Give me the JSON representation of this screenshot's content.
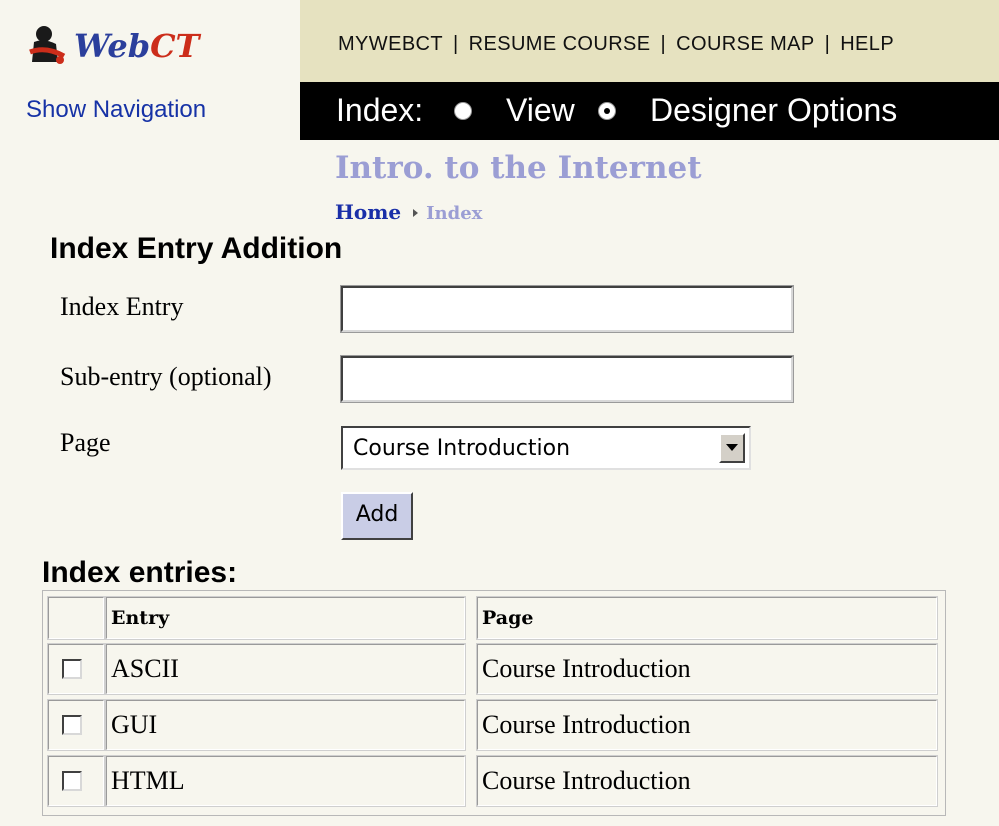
{
  "header": {
    "logo_text_web": "Web",
    "logo_text_ct": "CT",
    "show_navigation": "Show Navigation",
    "links": [
      "MYWEBCT",
      "RESUME COURSE",
      "COURSE MAP",
      "HELP"
    ],
    "separator": "|",
    "mode_label": "Index:",
    "mode_options": [
      "View",
      "Designer Options"
    ],
    "mode_selected": "Designer Options"
  },
  "page": {
    "course_title": "Intro. to the Internet",
    "breadcrumb": [
      "Home",
      "Index"
    ]
  },
  "form": {
    "title": "Index Entry Addition",
    "index_entry_label": "Index Entry",
    "index_entry_value": "",
    "sub_entry_label": "Sub-entry (optional)",
    "sub_entry_value": "",
    "page_label": "Page",
    "page_selected": "Course Introduction",
    "add_button": "Add"
  },
  "entries": {
    "title": "Index entries:",
    "columns": [
      "Entry",
      "Page"
    ],
    "rows": [
      {
        "entry": "ASCII",
        "page": "Course Introduction"
      },
      {
        "entry": "GUI",
        "page": "Course Introduction"
      },
      {
        "entry": "HTML",
        "page": "Course Introduction"
      }
    ]
  },
  "colors": {
    "accent_blue": "#1632a6",
    "title_lavender": "#9b9ed4",
    "header_bar": "#e6e2c0",
    "page_background": "#f7f6ee"
  }
}
